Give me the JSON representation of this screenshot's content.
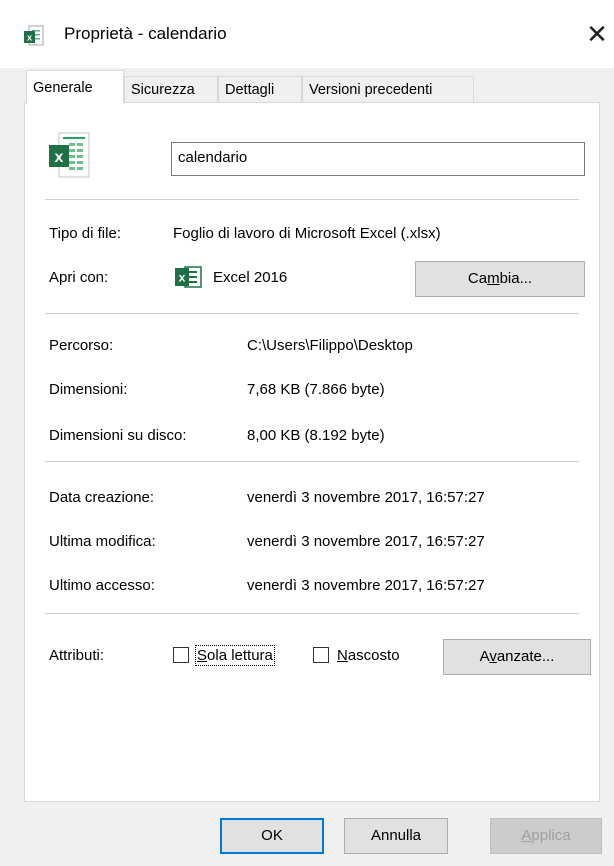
{
  "window": {
    "title": "Proprietà - calendario",
    "close_symbol": "✕",
    "icon": "excel-file-icon"
  },
  "tabs": [
    {
      "label": "Generale",
      "active": true
    },
    {
      "label": "Sicurezza",
      "active": false
    },
    {
      "label": "Dettagli",
      "active": false
    },
    {
      "label": "Versioni precedenti",
      "active": false
    }
  ],
  "general": {
    "file_name": "calendario",
    "file_type_label": "Tipo di file:",
    "file_type_value": "Foglio di lavoro di Microsoft Excel (.xlsx)",
    "open_with_label": "Apri con:",
    "open_with_value": "Excel 2016",
    "change_button": {
      "pre": "Ca",
      "key": "m",
      "post": "bia..."
    },
    "path_label": "Percorso:",
    "path_value": "C:\\Users\\Filippo\\Desktop",
    "size_label": "Dimensioni:",
    "size_value": "7,68 KB (7.866 byte)",
    "disk_size_label": "Dimensioni su disco:",
    "disk_size_value": "8,00 KB (8.192 byte)",
    "created_label": "Data creazione:",
    "created_value": "venerdì 3 novembre 2017, 16:57:27",
    "modified_label": "Ultima modifica:",
    "modified_value": "venerdì 3 novembre 2017, 16:57:27",
    "accessed_label": "Ultimo accesso:",
    "accessed_value": "venerdì 3 novembre 2017, 16:57:27",
    "attributes_label": "Attributi:",
    "readonly": {
      "key": "S",
      "rest": "ola lettura",
      "checked": false
    },
    "hidden": {
      "key": "N",
      "rest": "ascosto",
      "checked": false
    },
    "advanced_button": {
      "pre": "A",
      "key": "v",
      "post": "anzate..."
    }
  },
  "footer": {
    "ok": "OK",
    "cancel": "Annulla",
    "apply": {
      "key": "A",
      "rest": "pplica",
      "disabled": true
    }
  },
  "colors": {
    "excel_green": "#1e7145",
    "accent_blue": "#0078d7",
    "dialog_bg": "#f0f0f0"
  }
}
